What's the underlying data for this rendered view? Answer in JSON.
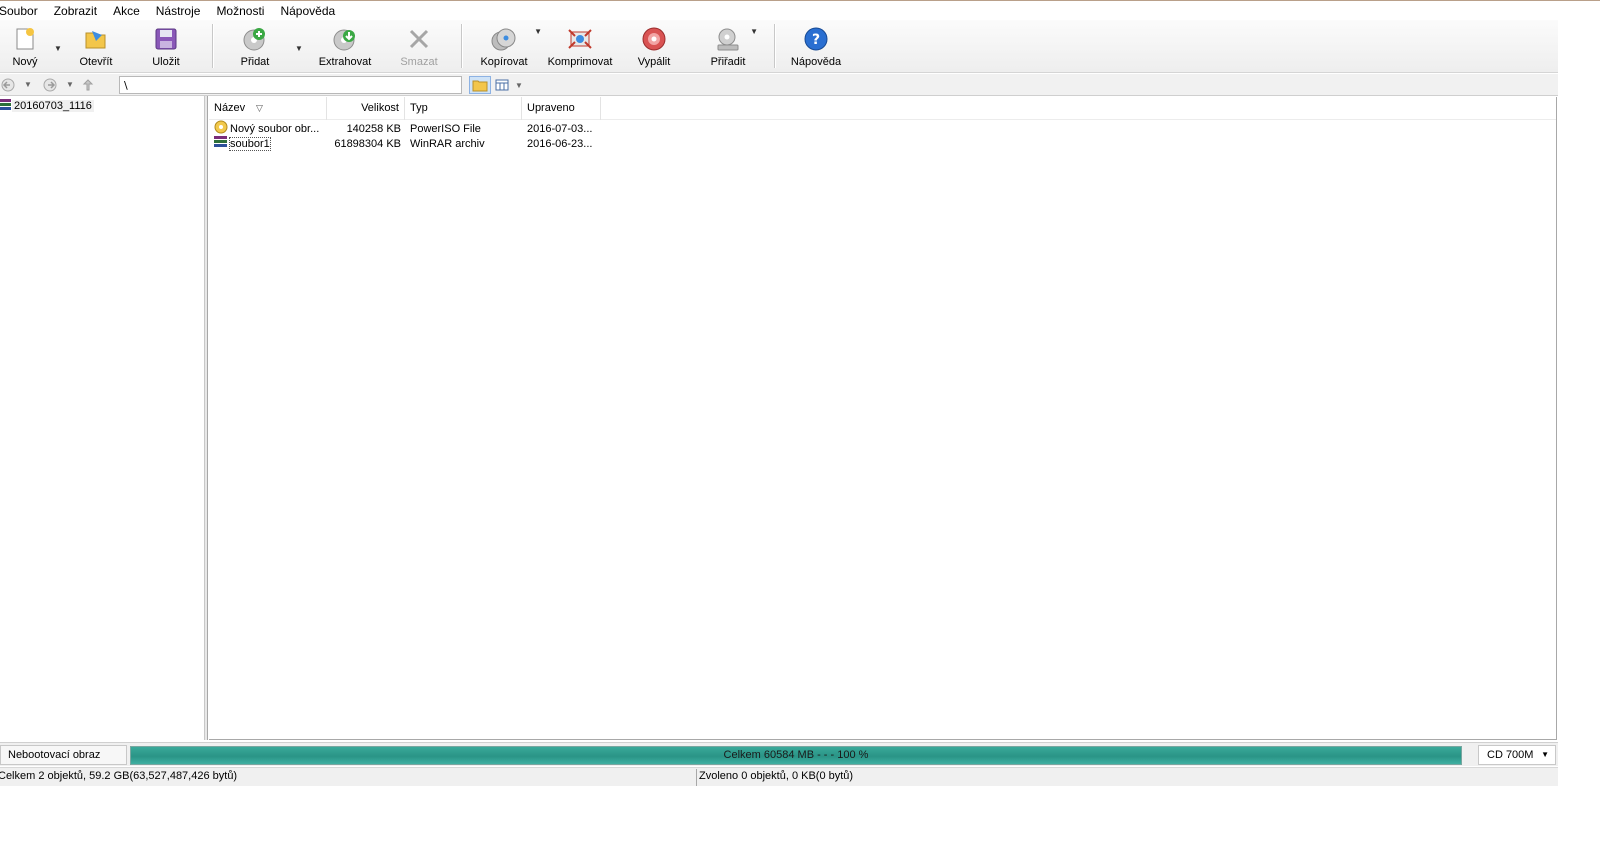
{
  "menu": [
    "Soubor",
    "Zobrazit",
    "Akce",
    "Nástroje",
    "Možnosti",
    "Nápověda"
  ],
  "toolbar": {
    "new": "Nový",
    "open": "Otevřít",
    "save": "Uložit",
    "add": "Přidat",
    "extract": "Extrahovat",
    "delete": "Smazat",
    "copy": "Kopírovat",
    "compress": "Komprimovat",
    "burn": "Vypálit",
    "mount": "Přiřadit",
    "help": "Nápověda"
  },
  "address": {
    "path": "\\"
  },
  "tree": {
    "root": "20160703_1116"
  },
  "columns": {
    "name": "Název",
    "size": "Velikost",
    "type": "Typ",
    "modified": "Upraveno"
  },
  "files": [
    {
      "name": "Nový soubor obr...",
      "size": "140258 KB",
      "type": "PowerISO File",
      "modified": "2016-07-03...",
      "icon": "iso-file-icon"
    },
    {
      "name": "soubor1",
      "size": "61898304 KB",
      "type": "WinRAR archiv",
      "modified": "2016-06-23...",
      "icon": "winrar-archive-icon"
    }
  ],
  "capacity": {
    "boot_label": "Nebootovací obraz",
    "summary": "Celkem  60584 MB   - - -  100 %",
    "fill_fraction": 1.0,
    "media": "CD 700M"
  },
  "status": {
    "left": "Celkem 2 objektů, 59.2 GB(63,527,487,426 bytů)",
    "right": "Zvoleno 0 objektů, 0 KB(0 bytů)"
  },
  "colors": {
    "progress_fill": "#2a9486",
    "help_icon": "#2a6fd1"
  }
}
